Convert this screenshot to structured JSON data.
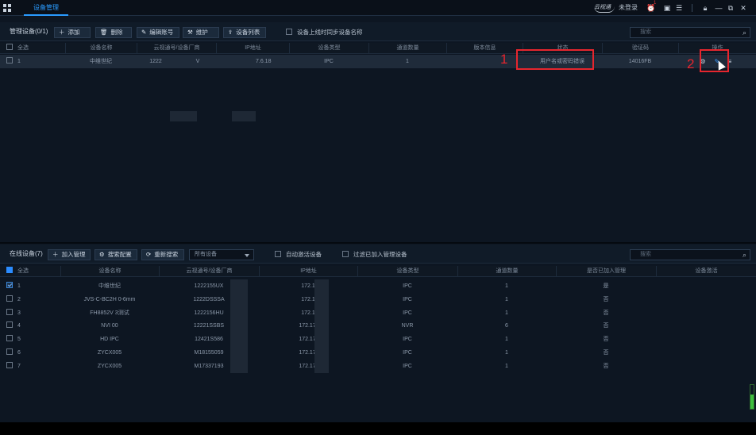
{
  "titlebar": {
    "active_tab": "设备管理",
    "brand": "云视通",
    "login_status": "未登录",
    "alarm_count": "1",
    "icons": [
      "app-grid-icon",
      "alarm-icon",
      "message-icon",
      "list-icon",
      "lock-icon",
      "minimize-icon",
      "restore-icon",
      "close-icon"
    ]
  },
  "managed": {
    "title": "管理设备(0/1)",
    "buttons": {
      "add": "添加",
      "delete": "删除",
      "edit_account": "编辑账号",
      "maintain": "维护",
      "device_list": "设备列表"
    },
    "sync_name_label": "设备上线时同步设备名称",
    "search_placeholder": "搜索",
    "columns": [
      "全选",
      "设备名称",
      "云视通号/设备厂商",
      "IP地址",
      "设备类型",
      "通道数量",
      "版本信息",
      "状态",
      "验证码",
      "操作"
    ],
    "rows": [
      {
        "index": "1",
        "name": "中维世纪",
        "cloud_id": "1222",
        "cloud_tail": "V",
        "ip_tail": "7.6.18",
        "type": "IPC",
        "channels": "1",
        "version": "",
        "status": "用户名或密码错误",
        "verify_code": "14016FB"
      }
    ]
  },
  "annotations": {
    "label1": "1",
    "label2": "2"
  },
  "online": {
    "title": "在线设备(7)",
    "buttons": {
      "join_manage": "加入管理",
      "search_config": "搜索配置",
      "re_search": "重新搜索"
    },
    "filter_selected": "所有设备",
    "auto_activate_label": "自动激活设备",
    "filter_added_label": "过滤已加入管理设备",
    "search_placeholder": "搜索",
    "columns": [
      "全选",
      "设备名称",
      "云视通号/设备厂商",
      "IP地址",
      "设备类型",
      "通道数量",
      "是否已加入管理",
      "设备激活"
    ],
    "rows": [
      {
        "index": "1",
        "checked": true,
        "name": "中维世纪",
        "cloud_id": "1222155UX",
        "ip": "172.1",
        "type": "IPC",
        "channels": "1",
        "managed": "是"
      },
      {
        "index": "2",
        "checked": false,
        "name": "JVS-C-BC2H     0-6mm",
        "cloud_id": "1222DSSSA",
        "ip": "172.1",
        "type": "IPC",
        "channels": "1",
        "managed": "否"
      },
      {
        "index": "3",
        "checked": false,
        "name": "FH8852V     3测试",
        "cloud_id": "1222156HU",
        "ip": "172.1",
        "type": "IPC",
        "channels": "1",
        "managed": "否"
      },
      {
        "index": "4",
        "checked": false,
        "name": "NVI      00",
        "cloud_id": "12221SSBS",
        "ip": "172.17.",
        "type": "NVR",
        "channels": "6",
        "managed": "否"
      },
      {
        "index": "5",
        "checked": false,
        "name": "HD IPC",
        "cloud_id": "12421S586",
        "ip": "172.17.",
        "type": "IPC",
        "channels": "1",
        "managed": "否"
      },
      {
        "index": "6",
        "checked": false,
        "name": "ZYCX005",
        "cloud_id": "M18155059",
        "ip": "172.17.",
        "type": "IPC",
        "channels": "1",
        "managed": "否"
      },
      {
        "index": "7",
        "checked": false,
        "name": "ZYCX005",
        "cloud_id": "M17337193",
        "ip": "172.17.",
        "type": "IPC",
        "channels": "1",
        "managed": "否"
      }
    ]
  }
}
